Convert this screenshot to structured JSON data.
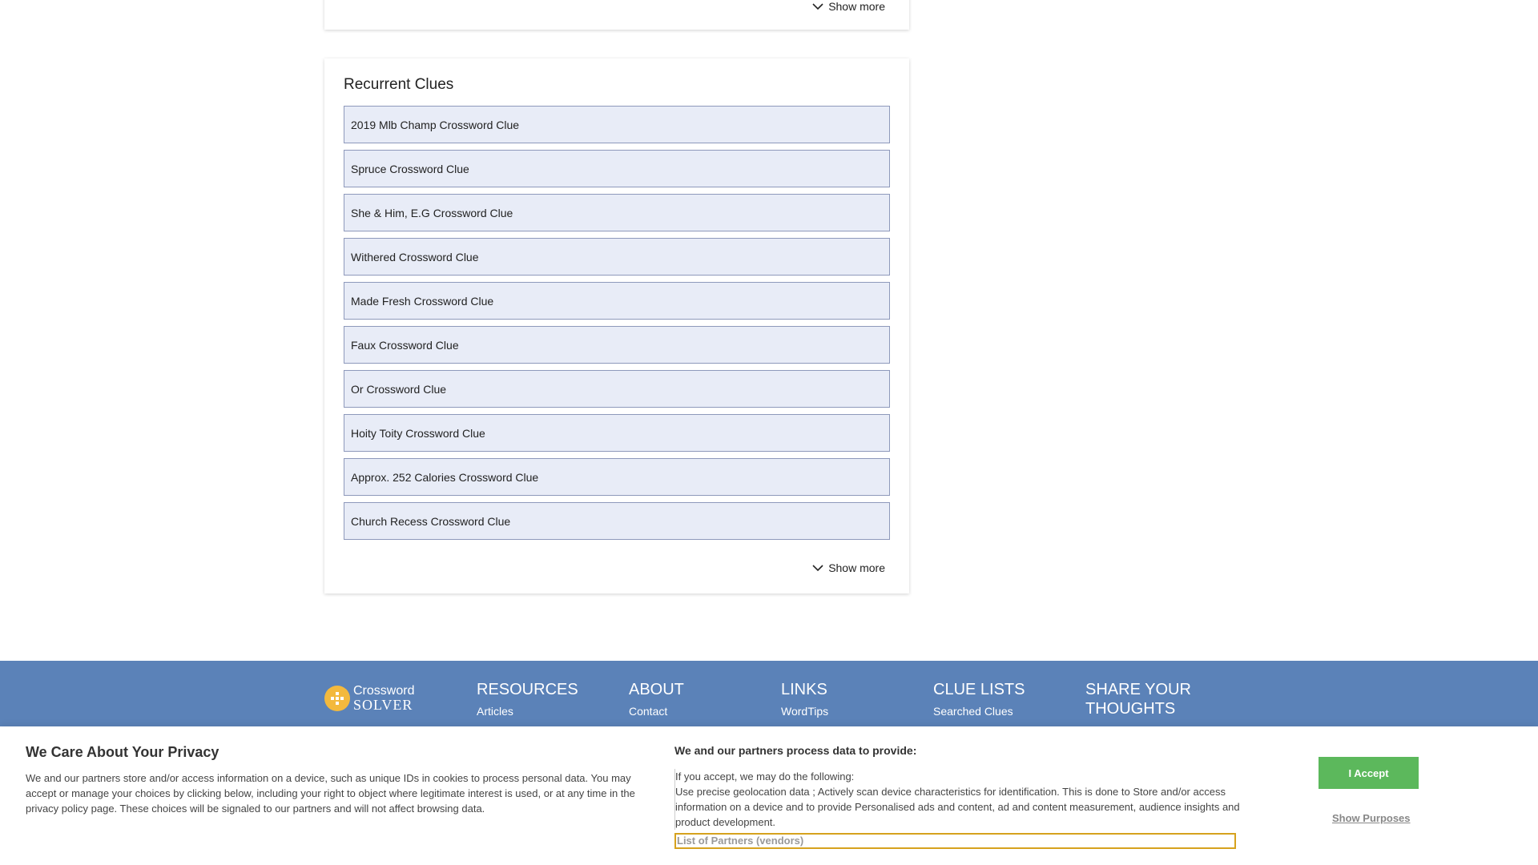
{
  "top_card": {
    "show_more": "Show more"
  },
  "recurrent": {
    "title": "Recurrent Clues",
    "items": [
      "2019 Mlb Champ Crossword Clue",
      "Spruce Crossword Clue",
      "She & Him, E.G Crossword Clue",
      "Withered Crossword Clue",
      "Made Fresh Crossword Clue",
      "Faux Crossword Clue",
      "Or Crossword Clue",
      "Hoity Toity Crossword Clue",
      "Approx. 252 Calories Crossword Clue",
      "Church Recess Crossword Clue"
    ],
    "show_more": "Show more"
  },
  "footer": {
    "logo": {
      "line1": "Crossword",
      "line2": "SOLVER",
      "icon": "crossword-grid-icon"
    },
    "columns": [
      {
        "heading": "RESOURCES",
        "links": [
          "Articles"
        ]
      },
      {
        "heading": "ABOUT",
        "links": [
          "Contact"
        ]
      },
      {
        "heading": "LINKS",
        "links": [
          "WordTips"
        ]
      },
      {
        "heading": "CLUE LISTS",
        "links": [
          "Searched Clues"
        ]
      },
      {
        "heading": "SHARE YOUR THOUGHTS",
        "links": []
      }
    ],
    "colors": {
      "background": "#5b82b8",
      "logo_accent": "#f3b93d"
    }
  },
  "consent": {
    "title": "We Care About Your Privacy",
    "text": "We and our partners store and/or access information on a device, such as unique IDs in cookies to process personal data. You may accept or manage your choices by clicking below, including your right to object where legitimate interest is used, or at any time in the privacy policy page. These choices will be signaled to our partners and will not affect browsing data.",
    "purposes_title": "We and our partners process data to provide:",
    "purposes_intro": "If you accept, we may do the following:",
    "purposes_text": "Use precise geolocation data ; Actively scan device characteristics for identification. This is done to Store and/or access information on a device and to provide Personalised ads and content, ad and content measurement, audience insights and product development.",
    "partners_link": "List of Partners (vendors)",
    "accept_label": "I Accept",
    "show_purposes_label": "Show Purposes",
    "colors": {
      "accept": "#5cb85c",
      "focus_outline": "#d6a21e"
    }
  }
}
